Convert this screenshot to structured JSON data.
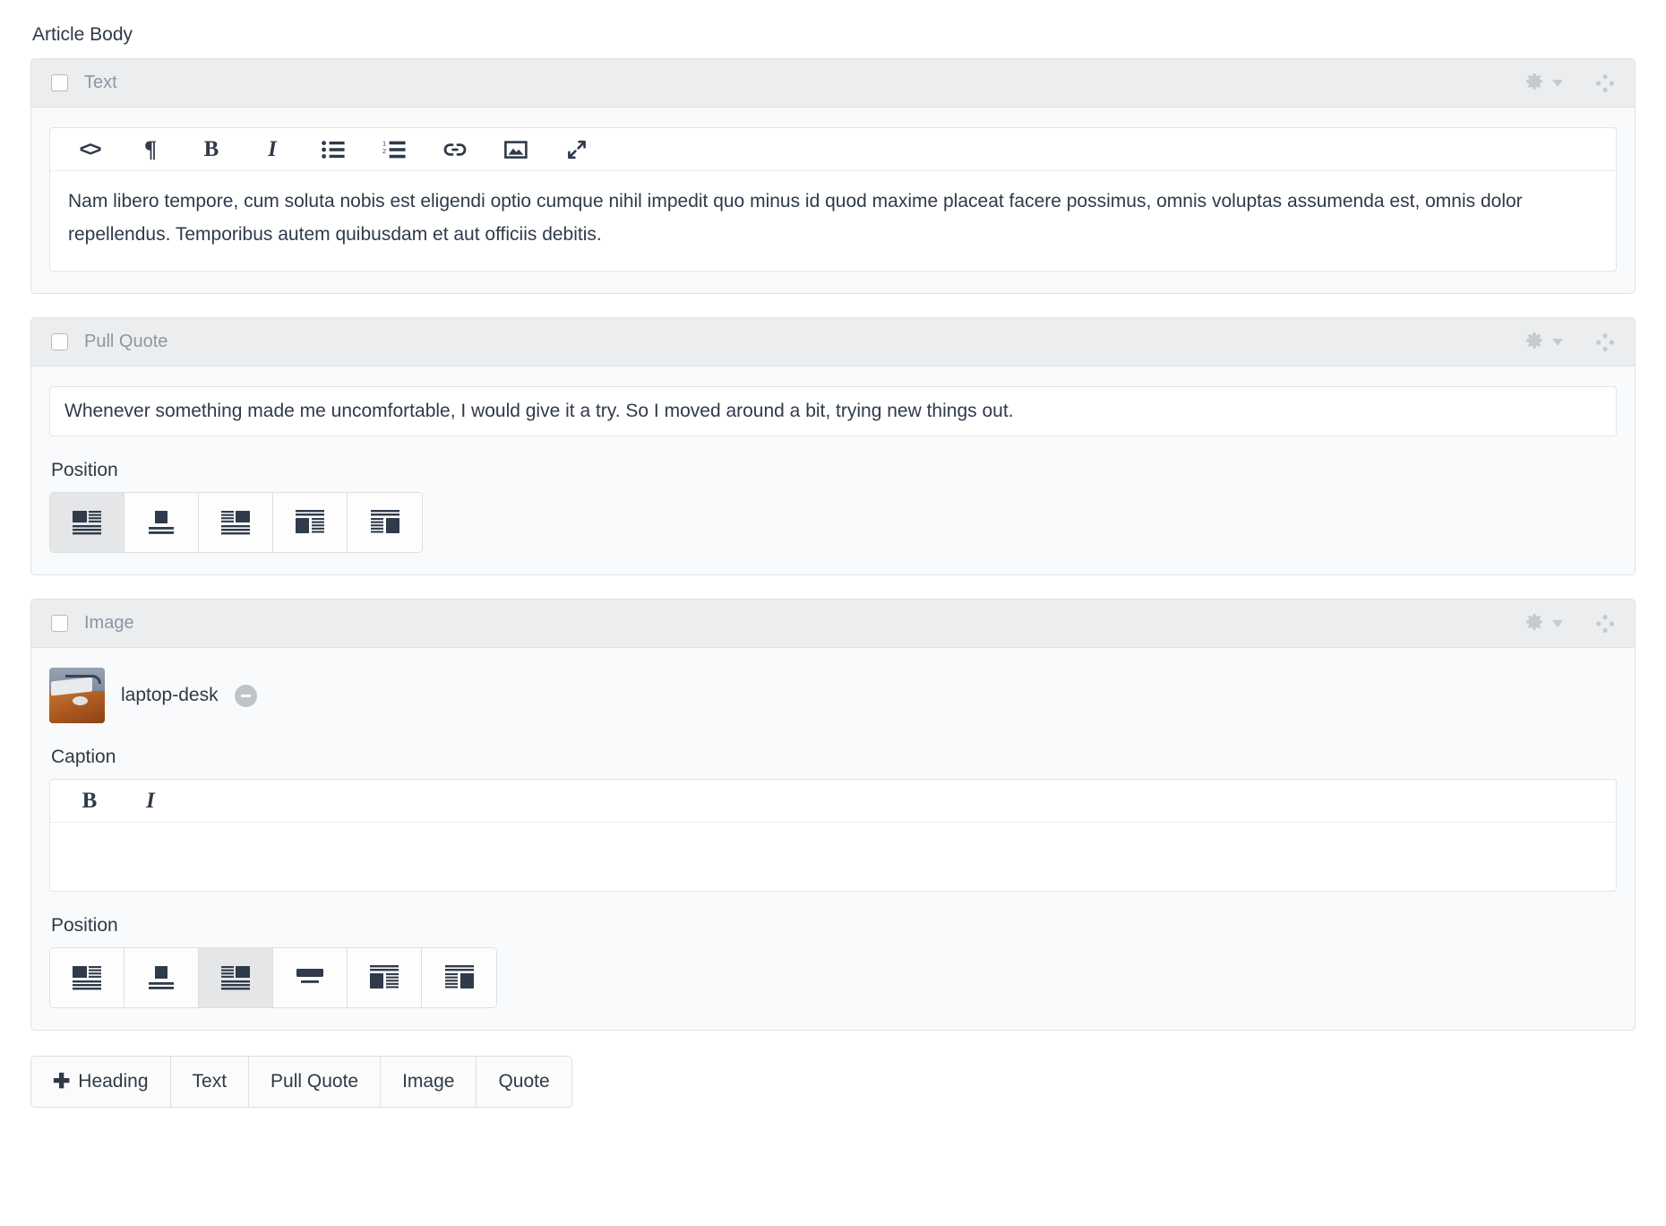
{
  "field_label": "Article Body",
  "colors": {
    "panel_header_bg": "#ebedef",
    "panel_body_bg": "#f9fafb",
    "border": "#dfe3e6",
    "text": "#2f3a4a",
    "muted_label": "#8c97a3",
    "active_button_bg": "#e4e6e8",
    "icon_dark": "#2f3a4a",
    "icon_gray": "#c6cacd"
  },
  "blocks": [
    {
      "type": "text",
      "title": "Text",
      "checkbox_checked": false,
      "gear_icon": "gear-icon",
      "gear_caret_icon": "chevron-down-icon",
      "drag_icon": "drag-handle-icon",
      "toolbar": [
        {
          "name": "code-button",
          "label": "<>",
          "icon": "code-icon"
        },
        {
          "name": "paragraph-button",
          "label": "¶",
          "icon": "paragraph-icon"
        },
        {
          "name": "bold-button",
          "label": "B",
          "icon": "bold-icon"
        },
        {
          "name": "italic-button",
          "label": "I",
          "icon": "italic-icon"
        },
        {
          "name": "bullet-list-button",
          "label": "",
          "icon": "bullet-list-icon"
        },
        {
          "name": "numbered-list-button",
          "label": "",
          "icon": "numbered-list-icon"
        },
        {
          "name": "link-button",
          "label": "",
          "icon": "link-icon"
        },
        {
          "name": "image-button",
          "label": "",
          "icon": "image-icon"
        },
        {
          "name": "expand-button",
          "label": "",
          "icon": "expand-arrows-icon"
        }
      ],
      "body_text": "Nam libero tempore, cum soluta nobis est eligendi optio cumque nihil impedit quo minus id quod maxime placeat facere possimus, omnis voluptas assumenda est, omnis dolor repellendus. Temporibus autem quibusdam et aut officiis debitis."
    },
    {
      "type": "pull_quote",
      "title": "Pull Quote",
      "checkbox_checked": false,
      "quote_value": "Whenever something made me uncomfortable, I would give it a try. So I moved around a bit, trying new things out.",
      "quote_placeholder": "",
      "position_label": "Position",
      "position_selected_index": 0,
      "position_options": [
        {
          "name": "position-left-top",
          "icon": "align-block-left-icon"
        },
        {
          "name": "position-center-top",
          "icon": "align-block-center-icon"
        },
        {
          "name": "position-right-top",
          "icon": "align-block-right-icon"
        },
        {
          "name": "position-wrap-left",
          "icon": "wrap-block-left-icon"
        },
        {
          "name": "position-wrap-right",
          "icon": "wrap-block-right-icon"
        }
      ]
    },
    {
      "type": "image",
      "title": "Image",
      "checkbox_checked": false,
      "image_name": "laptop-desk",
      "remove_label": "−",
      "caption_label": "Caption",
      "caption_value": "",
      "caption_toolbar": [
        {
          "name": "caption-bold-button",
          "label": "B",
          "icon": "bold-icon"
        },
        {
          "name": "caption-italic-button",
          "label": "I",
          "icon": "italic-icon"
        }
      ],
      "position_label": "Position",
      "position_selected_index": 2,
      "position_options": [
        {
          "name": "position-left-top",
          "icon": "align-block-left-icon"
        },
        {
          "name": "position-center-top",
          "icon": "align-block-center-icon"
        },
        {
          "name": "position-right-top",
          "icon": "align-block-right-icon"
        },
        {
          "name": "position-full-width",
          "icon": "full-width-block-icon"
        },
        {
          "name": "position-wrap-left",
          "icon": "wrap-block-left-icon"
        },
        {
          "name": "position-wrap-right",
          "icon": "wrap-block-right-icon"
        }
      ]
    }
  ],
  "add_blocks": {
    "plus_icon": "plus-icon",
    "buttons": [
      {
        "name": "add-heading-button",
        "label": "Heading",
        "has_plus": true
      },
      {
        "name": "add-text-button",
        "label": "Text",
        "has_plus": false
      },
      {
        "name": "add-pull-quote-button",
        "label": "Pull Quote",
        "has_plus": false
      },
      {
        "name": "add-image-button",
        "label": "Image",
        "has_plus": false
      },
      {
        "name": "add-quote-button",
        "label": "Quote",
        "has_plus": false
      }
    ]
  }
}
